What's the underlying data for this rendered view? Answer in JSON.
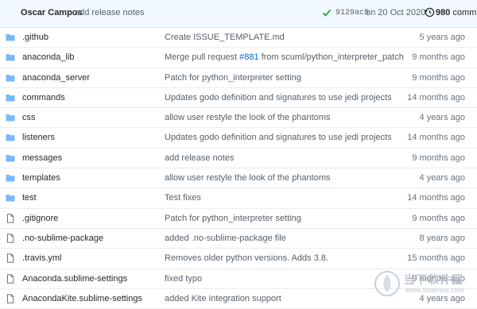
{
  "header": {
    "author": "Oscar Campos",
    "message": "add release notes",
    "hash": "9129ac5",
    "date": "on 20 Oct 2020",
    "commit_count": "980",
    "commit_label": "commits"
  },
  "files": [
    {
      "name": ".github",
      "type": "folder",
      "message": "Create ISSUE_TEMPLATE.md",
      "age": "5 years ago"
    },
    {
      "name": "anaconda_lib",
      "type": "folder",
      "message_pre": "Merge pull request ",
      "message_link": "#881",
      "message_post": " from scuml/python_interpreter_patch",
      "age": "9 months ago"
    },
    {
      "name": "anaconda_server",
      "type": "folder",
      "message": "Patch for python_interpreter setting",
      "age": "9 months ago"
    },
    {
      "name": "commands",
      "type": "folder",
      "message": "Updates godo definition and signatures to use jedi projects",
      "age": "14 months ago"
    },
    {
      "name": "css",
      "type": "folder",
      "message": "allow user restyle the look of the phantoms",
      "age": "4 years ago"
    },
    {
      "name": "listeners",
      "type": "folder",
      "message": "Updates godo definition and signatures to use jedi projects",
      "age": "14 months ago"
    },
    {
      "name": "messages",
      "type": "folder",
      "message": "add release notes",
      "age": "9 months ago"
    },
    {
      "name": "templates",
      "type": "folder",
      "message": "allow user restyle the look of the phantoms",
      "age": "4 years ago"
    },
    {
      "name": "test",
      "type": "folder",
      "message": "Test fixes",
      "age": "14 months ago"
    },
    {
      "name": ".gitignore",
      "type": "file",
      "message": "Patch for python_interpreter setting",
      "age": "9 months ago"
    },
    {
      "name": ".no-sublime-package",
      "type": "file",
      "message": "added .no-sublime-package file",
      "age": "8 years ago"
    },
    {
      "name": ".travis.yml",
      "type": "file",
      "message": "Removes older python versions. Adds 3.8.",
      "age": "15 months ago"
    },
    {
      "name": "Anaconda.sublime-settings",
      "type": "file",
      "message": "fixed typo",
      "age": "9 months ago"
    },
    {
      "name": "AnacondaKite.sublime-settings",
      "type": "file",
      "message": "added Kite integration support",
      "age": "4 years ago"
    }
  ],
  "watermark": {
    "text": "当下软件园",
    "subtext": "www.downxia.com"
  },
  "colors": {
    "folder": "#79b8ff",
    "link": "#0366d6",
    "check": "#28a745"
  }
}
